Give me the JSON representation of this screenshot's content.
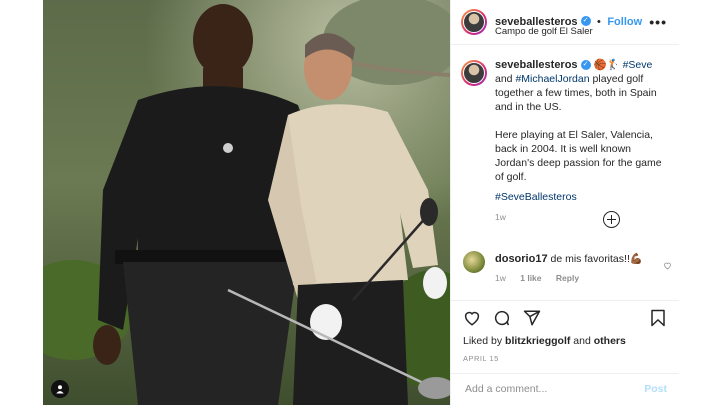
{
  "post": {
    "photo_alt": "",
    "header": {
      "username": "seveballesteros",
      "follow_label": "Follow",
      "location": "Campo de golf El Saler",
      "more_label": "•••"
    },
    "caption": {
      "username": "seveballesteros",
      "emoji": "🏀🏌",
      "hashtag_seve": "#Seve",
      "and_word": "and",
      "line1_rest": "played golf together a few times, both in Spain and in the US.",
      "hashtag_mj": "#MichaelJordan",
      "paragraph2": "Here playing at El Saler, Valencia, back in 2004. It is well known Jordan's deep passion for the game of golf.",
      "hashtag_sb": "#SeveBallesteros",
      "time": "1w"
    },
    "comments": [
      {
        "username": "dosorio17",
        "text": "de mis favoritas!!💪🏾",
        "time": "1w",
        "likes": "1 like",
        "reply_label": "Reply"
      }
    ],
    "likes": {
      "prefix": "Liked by",
      "user": "blitzkrieggolf",
      "conj": "and",
      "others": "others"
    },
    "date": "APRIL 15",
    "add_comment": {
      "placeholder": "Add a comment...",
      "post_label": "Post"
    },
    "icons": [
      "heart-icon",
      "comment-icon",
      "share-icon",
      "bookmark-icon",
      "load-more-icon",
      "tag-user-icon",
      "verified-icon",
      "comment-like-icon"
    ],
    "colors": {
      "link": "#00376b",
      "follow": "#3897f0",
      "verified": "#3897f0",
      "muted": "#8e8e8e"
    }
  }
}
